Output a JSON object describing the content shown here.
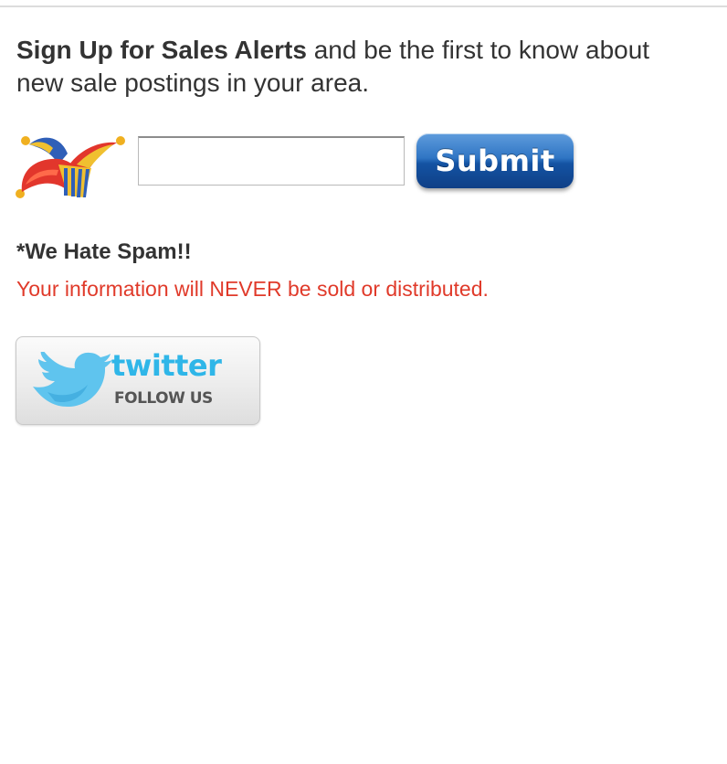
{
  "intro": {
    "bold_text": "Sign Up for Sales Alerts",
    "rest_text": " and be the first to know about new sale postings in your area."
  },
  "signup": {
    "email_value": "",
    "email_placeholder": "",
    "submit_label": "Submit"
  },
  "spam": {
    "heading": "*We Hate Spam!!",
    "note": "Your information will NEVER be sold or distributed."
  },
  "twitter": {
    "brand_word": "twitter",
    "follow_label": "FOLLOW US"
  },
  "colors": {
    "warning_red": "#e03a2a",
    "submit_blue": "#1453a3",
    "twitter_blue": "#2fb6e8"
  },
  "icons": {
    "jester": "jester-hat-icon",
    "twitter": "twitter-bird-icon"
  }
}
